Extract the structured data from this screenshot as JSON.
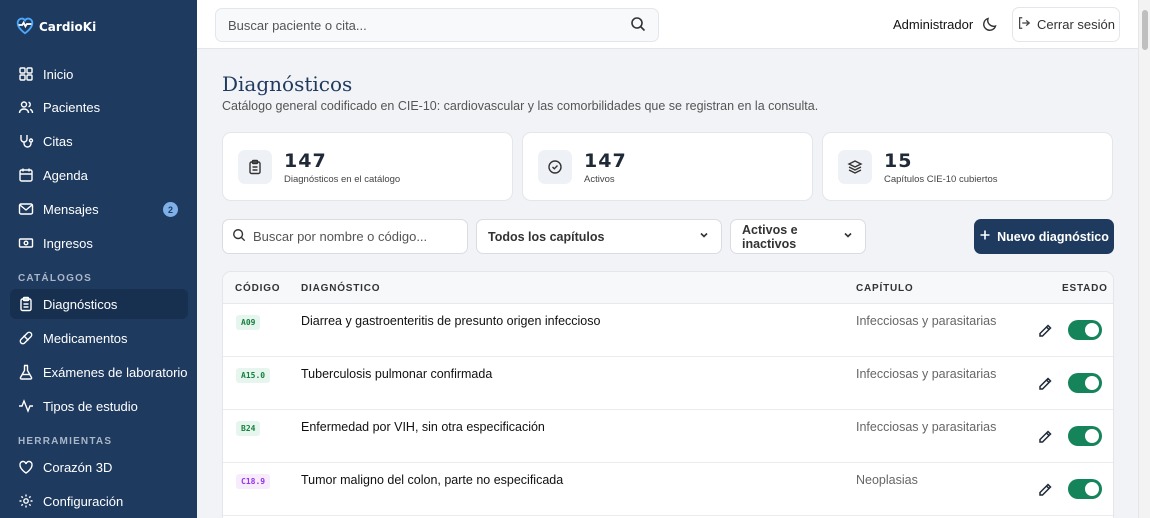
{
  "app": {
    "name": "CardioKi"
  },
  "sidebar": {
    "items": [
      {
        "label": "Inicio",
        "icon": "grid-icon"
      },
      {
        "label": "Pacientes",
        "icon": "users-icon"
      },
      {
        "label": "Citas",
        "icon": "stethoscope-icon"
      },
      {
        "label": "Agenda",
        "icon": "calendar-icon"
      },
      {
        "label": "Mensajes",
        "icon": "mail-icon",
        "badge": "2"
      },
      {
        "label": "Ingresos",
        "icon": "banknote-icon"
      }
    ],
    "catalog_label": "CATÁLOGOS",
    "catalog_items": [
      {
        "label": "Diagnósticos",
        "icon": "clipboard-icon",
        "active": true
      },
      {
        "label": "Medicamentos",
        "icon": "pill-icon"
      },
      {
        "label": "Exámenes de laboratorio",
        "icon": "flask-icon"
      },
      {
        "label": "Tipos de estudio",
        "icon": "activity-icon"
      }
    ],
    "tools_label": "HERRAMIENTAS",
    "tools_items": [
      {
        "label": "Corazón 3D",
        "icon": "heart-icon"
      },
      {
        "label": "Configuración",
        "icon": "gear-icon"
      }
    ]
  },
  "topbar": {
    "search_placeholder": "Buscar paciente o cita...",
    "user": "Administrador",
    "logout_label": "Cerrar sesión"
  },
  "page": {
    "title": "Diagnósticos",
    "subtitle": "Catálogo general codificado en CIE-10: cardiovascular y las comorbilidades que se registran en la consulta."
  },
  "stats": [
    {
      "value": "147",
      "label": "Diagnósticos en el catálogo",
      "icon": "clipboard-icon"
    },
    {
      "value": "147",
      "label": "Activos",
      "icon": "check-circle-icon"
    },
    {
      "value": "15",
      "label": "Capítulos CIE-10 cubiertos",
      "icon": "layers-icon"
    }
  ],
  "filters": {
    "search_placeholder": "Buscar por nombre o código...",
    "chapter_select": "Todos los capítulos",
    "status_select": "Activos e inactivos",
    "new_button": "Nuevo diagnóstico"
  },
  "table": {
    "headers": {
      "code": "CÓDIGO",
      "diagnosis": "DIAGNÓSTICO",
      "chapter": "CAPÍTULO",
      "status": "ESTADO"
    },
    "rows": [
      {
        "code": "A09",
        "diagnosis": "Diarrea y gastroenteritis de presunto origen infeccioso",
        "chapter": "Infecciosas y parasitarias",
        "active": true,
        "code_bg": "#e6f6ee",
        "code_color": "#15803d"
      },
      {
        "code": "A15.0",
        "diagnosis": "Tuberculosis pulmonar confirmada",
        "chapter": "Infecciosas y parasitarias",
        "active": true,
        "code_bg": "#e6f6ee",
        "code_color": "#15803d"
      },
      {
        "code": "B24",
        "diagnosis": "Enfermedad por VIH, sin otra especificación",
        "chapter": "Infecciosas y parasitarias",
        "active": true,
        "code_bg": "#e6f6ee",
        "code_color": "#15803d"
      },
      {
        "code": "C18.9",
        "diagnosis": "Tumor maligno del colon, parte no especificada",
        "chapter": "Neoplasias",
        "active": true,
        "code_bg": "#f6ecfb",
        "code_color": "#9333ea"
      }
    ]
  },
  "colors": {
    "sidebar": "#1e3a5f",
    "accent": "#1e3a5f",
    "toggle_on": "#16845a"
  }
}
